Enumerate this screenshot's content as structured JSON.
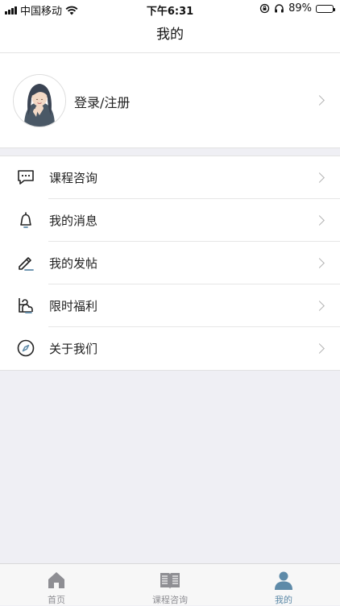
{
  "status_bar": {
    "carrier": "中国移动",
    "time": "下午6:31",
    "battery": "89%",
    "battery_level": 0.89
  },
  "nav": {
    "title": "我的"
  },
  "profile": {
    "login_label": "登录/注册"
  },
  "menu": {
    "items": [
      {
        "label": "课程咨询",
        "icon": "chat-bubble-icon"
      },
      {
        "label": "我的消息",
        "icon": "bell-icon"
      },
      {
        "label": "我的发帖",
        "icon": "pencil-icon"
      },
      {
        "label": "限时福利",
        "icon": "gift-icon"
      },
      {
        "label": "关于我们",
        "icon": "compass-icon"
      }
    ]
  },
  "tabs": [
    {
      "label": "首页",
      "icon": "home-icon",
      "active": false
    },
    {
      "label": "课程咨询",
      "icon": "book-icon",
      "active": false
    },
    {
      "label": "我的",
      "icon": "person-icon",
      "active": true
    }
  ],
  "colors": {
    "accent": "#5e8aa8",
    "background": "#efeff4",
    "inactive": "#8e8e93"
  }
}
